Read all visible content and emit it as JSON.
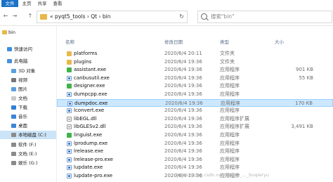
{
  "ribbon": {
    "tabs": [
      "文件",
      "主页",
      "共享",
      "查看"
    ]
  },
  "nav": {
    "back": "←",
    "forward": "→",
    "up": "↑"
  },
  "address": {
    "segments": "« pyqt5_tools › Qt › bin",
    "refresh": "↻"
  },
  "search": {
    "placeholder": "搜索\"bin\""
  },
  "sidebar": {
    "items": [
      {
        "label": "bin",
        "icon": "folder-icon"
      },
      {
        "label": "快速访问",
        "icon": "star-icon"
      },
      {
        "label": "此电脑",
        "icon": "computer-icon"
      },
      {
        "label": "3D 对象",
        "icon": "cube-icon"
      },
      {
        "label": "视频",
        "icon": "video-icon"
      },
      {
        "label": "图片",
        "icon": "picture-icon"
      },
      {
        "label": "文档",
        "icon": "document-icon"
      },
      {
        "label": "下载",
        "icon": "download-icon"
      },
      {
        "label": "音乐",
        "icon": "music-icon"
      },
      {
        "label": "桌面",
        "icon": "desktop-icon"
      },
      {
        "label": "本地磁盘 (C:)",
        "icon": "drive-icon"
      },
      {
        "label": "软件 (F:)",
        "icon": "drive-icon"
      },
      {
        "label": "文档 (E:)",
        "icon": "drive-icon"
      },
      {
        "label": "娱乐 (G:)",
        "icon": "drive-icon"
      }
    ]
  },
  "columns": {
    "name": "名称",
    "date": "修改日期",
    "type": "类型",
    "size": "大小"
  },
  "files": [
    {
      "name": "platforms",
      "date": "2020/6/4 20:11",
      "type": "文件夹",
      "size": "",
      "kind": "folder"
    },
    {
      "name": "plugins",
      "date": "2020/6/4 19:36",
      "type": "文件夹",
      "size": "",
      "kind": "folder"
    },
    {
      "name": "assistant.exe",
      "date": "2020/6/4 19:36",
      "type": "应用程序",
      "size": "901 KB",
      "kind": "qt"
    },
    {
      "name": "canbusutil.exe",
      "date": "2020/6/4 19:36",
      "type": "应用程序",
      "size": "55 KB",
      "kind": "exe"
    },
    {
      "name": "designer.exe",
      "date": "2020/6/4 19:36",
      "type": "应用程序",
      "size": "",
      "kind": "qt"
    },
    {
      "name": "dumpcpp.exe",
      "date": "2020/6/4 19:36",
      "type": "应用程序",
      "size": "",
      "kind": "exe"
    },
    {
      "name": "dumpdoc.exe",
      "date": "2020/6/4 19:36",
      "type": "应用程序",
      "size": "170 KB",
      "kind": "exe",
      "selected": true
    },
    {
      "name": "lconvert.exe",
      "date": "2020/6/4 19:36",
      "type": "应用程序",
      "size": "",
      "kind": "exe"
    },
    {
      "name": "libEGL.dll",
      "date": "2020/6/4 19:36",
      "type": "应用程序扩展",
      "size": "",
      "kind": "dll"
    },
    {
      "name": "libGLESv2.dll",
      "date": "2020/6/4 19:36",
      "type": "应用程序扩展",
      "size": "3,491 KB",
      "kind": "dll"
    },
    {
      "name": "linguist.exe",
      "date": "2020/6/4 19:36",
      "type": "应用程序",
      "size": "",
      "kind": "qt"
    },
    {
      "name": "lprodump.exe",
      "date": "2020/6/4 19:36",
      "type": "应用程序",
      "size": "",
      "kind": "exe"
    },
    {
      "name": "lrelease.exe",
      "date": "2020/6/4 19:36",
      "type": "应用程序",
      "size": "",
      "kind": "exe"
    },
    {
      "name": "lrelease-pro.exe",
      "date": "2020/6/4 19:36",
      "type": "应用程序",
      "size": "",
      "kind": "exe"
    },
    {
      "name": "lupdate.exe",
      "date": "2020/6/4 19:36",
      "type": "应用程序",
      "size": "",
      "kind": "exe"
    },
    {
      "name": "lupdate-pro.exe",
      "date": "2020/6/4 19:36",
      "type": "应用程序",
      "size": "",
      "kind": "exe"
    }
  ],
  "watermark": "https://blog.csdn.net/weixin_..._buqieryu",
  "colors": {
    "accent": "#1a73c7",
    "selection": "#cce8ff",
    "folder": "#e8b84a"
  }
}
